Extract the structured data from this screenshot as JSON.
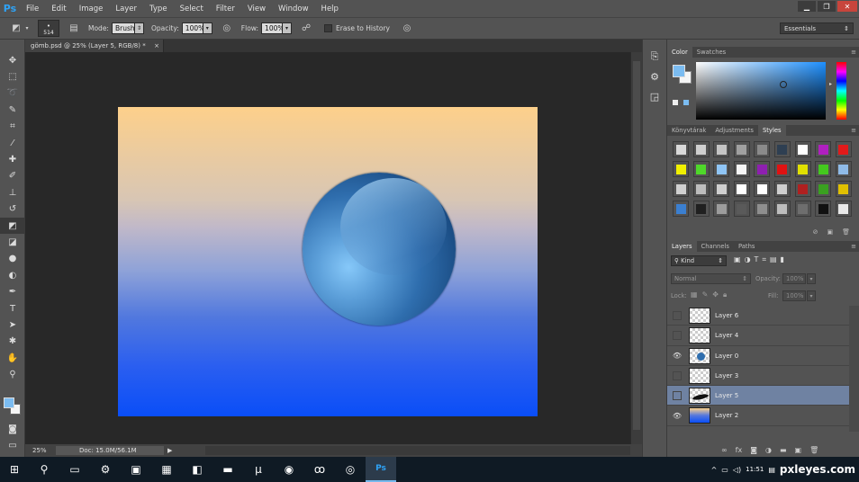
{
  "app": {
    "logo": "Ps"
  },
  "menu": [
    "File",
    "Edit",
    "Image",
    "Layer",
    "Type",
    "Select",
    "Filter",
    "View",
    "Window",
    "Help"
  ],
  "window_controls": {
    "minimize": "▁",
    "restore": "❐",
    "close": "✕"
  },
  "options": {
    "brush_size": "514",
    "mode_label": "Mode:",
    "mode_value": "Brush",
    "opacity_label": "Opacity:",
    "opacity_value": "100%",
    "flow_label": "Flow:",
    "flow_value": "100%",
    "erase_history_label": "Erase to History",
    "workspace": "Essentials"
  },
  "document": {
    "tab_title": "gömb.psd @ 25% (Layer 5, RGB/8) *",
    "tab_close": "×",
    "zoom": "25%",
    "doc_info": "Doc: 15.0M/56.1M",
    "status_arrow": "▶"
  },
  "canvas_colors": {
    "sky_top": "#fdd08b",
    "mid": "#c0b8c9",
    "bottom": "#0a4ef8",
    "sphere": "#2f6eae"
  },
  "tools": [
    {
      "name": "move-icon",
      "glyph": "✥"
    },
    {
      "name": "marquee-icon",
      "glyph": "⬚"
    },
    {
      "name": "lasso-icon",
      "glyph": "➰"
    },
    {
      "name": "quick-select-icon",
      "glyph": "✎"
    },
    {
      "name": "crop-icon",
      "glyph": "⌗"
    },
    {
      "name": "eyedropper-icon",
      "glyph": "⁄"
    },
    {
      "name": "healing-icon",
      "glyph": "✚"
    },
    {
      "name": "brush-icon",
      "glyph": "✐"
    },
    {
      "name": "stamp-icon",
      "glyph": "⊥"
    },
    {
      "name": "history-brush-icon",
      "glyph": "↺"
    },
    {
      "name": "eraser-icon",
      "glyph": "◩"
    },
    {
      "name": "bucket-icon",
      "glyph": "◪"
    },
    {
      "name": "blur-icon",
      "glyph": "●"
    },
    {
      "name": "dodge-icon",
      "glyph": "◐"
    },
    {
      "name": "pen-icon",
      "glyph": "✒"
    },
    {
      "name": "type-icon",
      "glyph": "T"
    },
    {
      "name": "path-select-icon",
      "glyph": "➤"
    },
    {
      "name": "shape-icon",
      "glyph": "✱"
    },
    {
      "name": "hand-icon",
      "glyph": "✋"
    },
    {
      "name": "zoom-icon",
      "glyph": "⚲"
    }
  ],
  "colors": {
    "foreground": "#7bbcf1",
    "background": "#f5f5f5"
  },
  "panels": {
    "color_tabs": [
      "Color",
      "Swatches"
    ],
    "style_tabs": [
      "Könyvtárak",
      "Adjustments",
      "Styles"
    ],
    "layer_tabs": [
      "Layers",
      "Channels",
      "Paths"
    ]
  },
  "styles": [
    "#d9d9d9",
    "#cfcfcf",
    "#c4c4c4",
    "#a0a0a0",
    "#8a8a8a",
    "#2e3f52",
    "#ffffff",
    "#b01fc0",
    "#e21a1a",
    "#f0f000",
    "#4fd82a",
    "#8fc5f5",
    "#f6f6f6",
    "#8e1fb0",
    "#e01212",
    "#e0e000",
    "#44c81e",
    "#8fbbe8",
    "#d0d0d0",
    "#bdbdbd",
    "#cfcfcf",
    "#ffffff",
    "#ffffff",
    "#cfcfcf",
    "#b02020",
    "#3aa020",
    "#e0c000",
    "#3b7fd0",
    "#202020",
    "#9c9c9c",
    "#5a5a5a",
    "#8e8e8e",
    "#bdbdbd",
    "#6e6e6e",
    "#111111",
    "#e8e8e8"
  ],
  "layers_panel": {
    "filter_label": "⚲ Kind",
    "blend_mode": "Normal",
    "opacity_label": "Opacity:",
    "opacity_value": "100%",
    "lock_label": "Lock:",
    "fill_label": "Fill:",
    "fill_value": "100%",
    "layers": [
      {
        "name": "Layer 6",
        "visible": false,
        "selected": false,
        "thumb": "empty"
      },
      {
        "name": "Layer 4",
        "visible": false,
        "selected": false,
        "thumb": "empty"
      },
      {
        "name": "Layer 0",
        "visible": true,
        "selected": false,
        "thumb": "sphere"
      },
      {
        "name": "Layer 3",
        "visible": false,
        "selected": false,
        "thumb": "empty"
      },
      {
        "name": "Layer 5",
        "visible": false,
        "selected": true,
        "thumb": "stroke"
      },
      {
        "name": "Layer 2",
        "visible": true,
        "selected": false,
        "thumb": "gradient"
      }
    ]
  },
  "taskbar": {
    "icons": [
      {
        "name": "windows-start-icon",
        "glyph": "⊞"
      },
      {
        "name": "search-icon",
        "glyph": "⚲"
      },
      {
        "name": "task-view-icon",
        "glyph": "▭"
      },
      {
        "name": "settings-gear-icon",
        "glyph": "⚙"
      },
      {
        "name": "store-icon",
        "glyph": "▣"
      },
      {
        "name": "calculator-icon",
        "glyph": "▦"
      },
      {
        "name": "notes-icon",
        "glyph": "◧"
      },
      {
        "name": "file-explorer-icon",
        "glyph": "▬"
      },
      {
        "name": "utorrent-icon",
        "glyph": "µ"
      },
      {
        "name": "browser-icon",
        "glyph": "◉"
      },
      {
        "name": "swirl-app-icon",
        "glyph": "ꝏ"
      },
      {
        "name": "chrome-icon",
        "glyph": "◎"
      },
      {
        "name": "photoshop-icon",
        "glyph": "Ps"
      }
    ],
    "clock_time": "11:51",
    "watermark": "pxleyes.com"
  }
}
